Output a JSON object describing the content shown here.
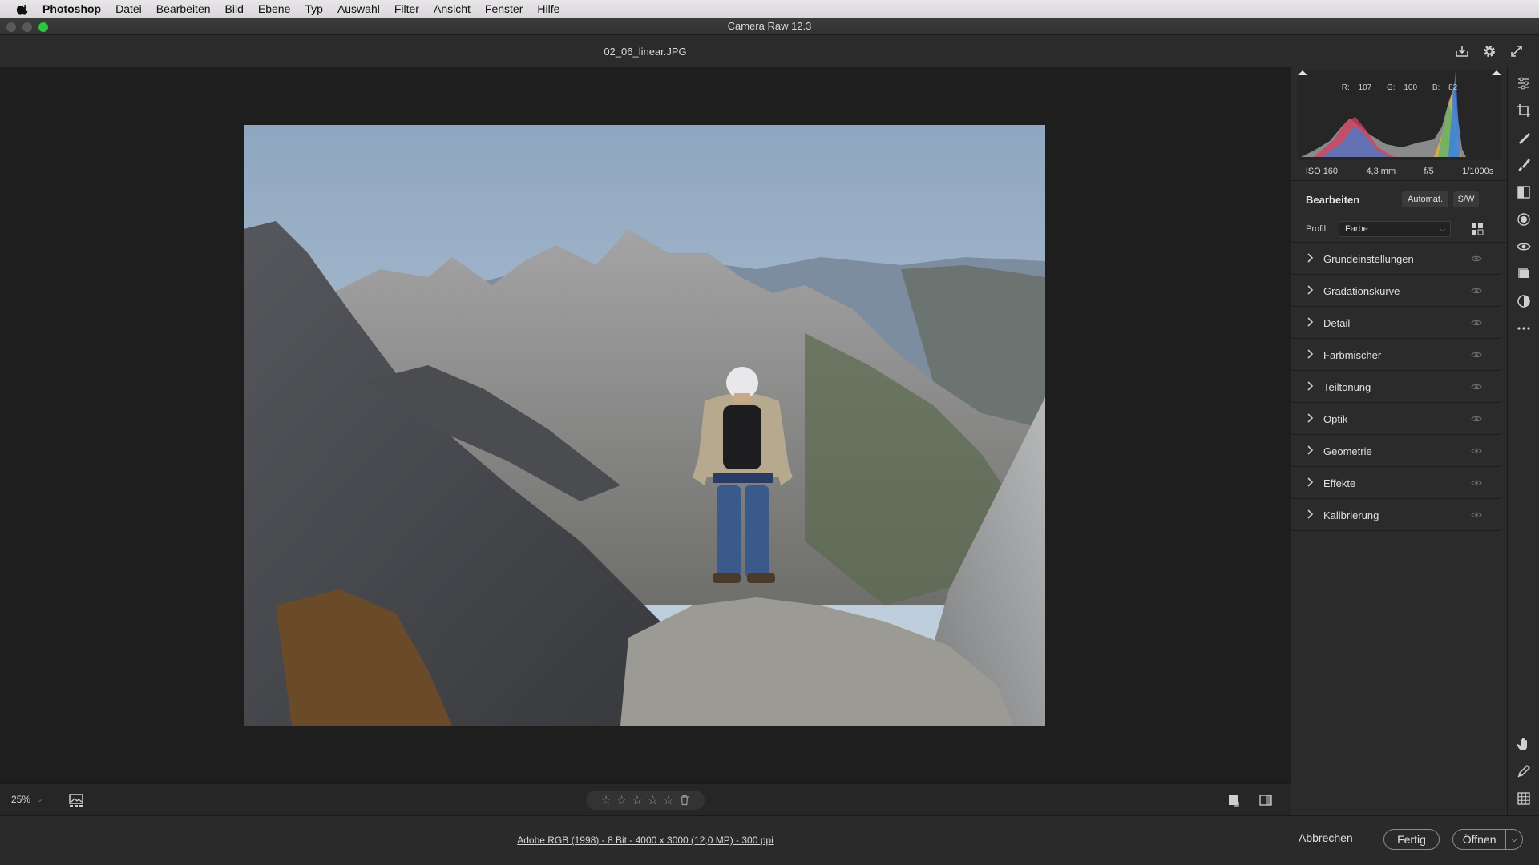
{
  "menubar": {
    "app_name": "Photoshop",
    "items": [
      "Datei",
      "Bearbeiten",
      "Bild",
      "Ebene",
      "Typ",
      "Auswahl",
      "Filter",
      "Ansicht",
      "Fenster",
      "Hilfe"
    ]
  },
  "window": {
    "title": "Camera Raw 12.3"
  },
  "file": {
    "name": "02_06_linear.JPG"
  },
  "histogram": {
    "r_label": "R:",
    "r": "107",
    "g_label": "G:",
    "g": "100",
    "b_label": "B:",
    "b": "82"
  },
  "exif": {
    "iso": "ISO 160",
    "focal": "4,3 mm",
    "aperture": "f/5",
    "shutter": "1/1000s"
  },
  "edit": {
    "title": "Bearbeiten",
    "auto_label": "Automat.",
    "bw_label": "S/W",
    "profile_label": "Profil",
    "profile_value": "Farbe"
  },
  "sections": [
    "Grundeinstellungen",
    "Gradationskurve",
    "Detail",
    "Farbmischer",
    "Teiltonung",
    "Optik",
    "Geometrie",
    "Effekte",
    "Kalibrierung"
  ],
  "bottombar": {
    "zoom": "25%"
  },
  "footer": {
    "workflow": "Adobe RGB (1998) - 8 Bit - 4000 x 3000 (12,0 MP) - 300 ppi",
    "cancel": "Abbrechen",
    "done": "Fertig",
    "open": "Öffnen"
  },
  "colors": {
    "accent_green": "#2dc441",
    "panel_bg": "#2b2b2b",
    "canvas_bg": "#1e1e1e"
  }
}
